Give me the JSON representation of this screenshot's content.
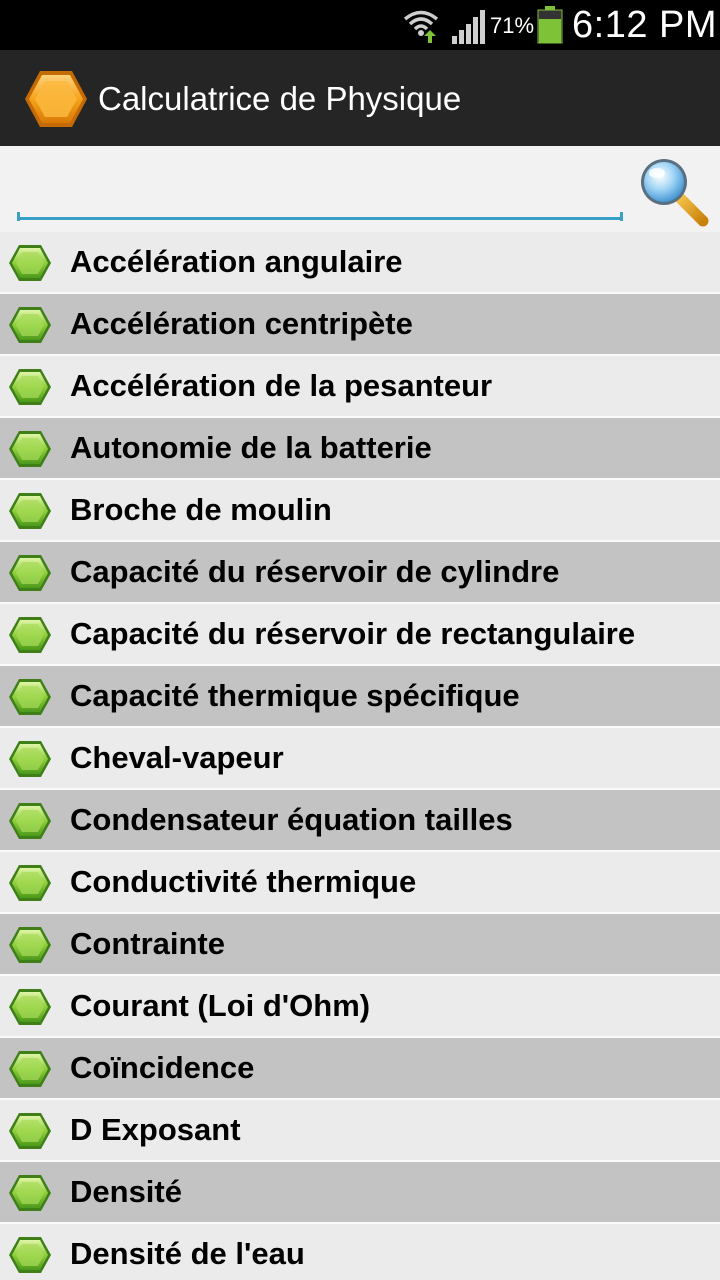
{
  "status_bar": {
    "battery_percent": "71%",
    "time": "6:12 PM",
    "icons": [
      "wifi-icon",
      "signal-icon",
      "battery-icon"
    ]
  },
  "app_bar": {
    "title": "Calculatrice de Physique",
    "icon": "hexagon-app-icon",
    "icon_color": "#f5a31c"
  },
  "search": {
    "value": "",
    "placeholder": "",
    "icon": "magnifier-icon",
    "accent": "#3a9fc7"
  },
  "list": {
    "bullet_icon": "green-hexagon-icon",
    "bullet_color": "#8fce3b",
    "items": [
      "Accélération angulaire",
      "Accélération centripète",
      "Accélération de la pesanteur",
      "Autonomie de la batterie",
      "Broche de moulin",
      "Capacité du réservoir de cylindre",
      "Capacité du réservoir de rectangulaire",
      "Capacité thermique spécifique",
      "Cheval-vapeur",
      "Condensateur équation tailles",
      "Conductivité thermique",
      "Contrainte",
      "Courant (Loi d'Ohm)",
      "Coïncidence",
      "D Exposant",
      "Densité",
      "Densité de l'eau"
    ]
  }
}
